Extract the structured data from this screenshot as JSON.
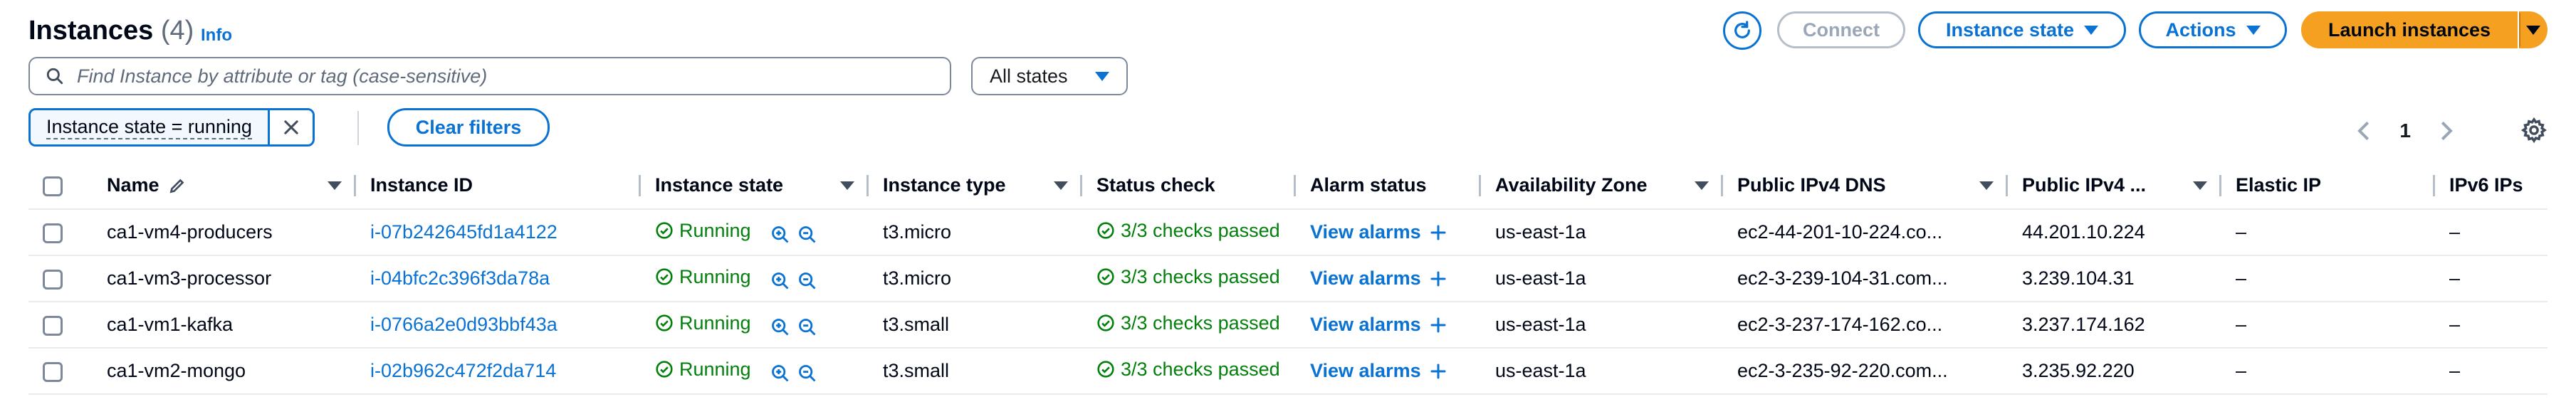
{
  "header": {
    "title": "Instances",
    "count": "(4)",
    "info": "Info",
    "connect": "Connect",
    "instance_state": "Instance state",
    "actions": "Actions",
    "launch": "Launch instances"
  },
  "filter": {
    "search_placeholder": "Find Instance by attribute or tag (case-sensitive)",
    "states_select": "All states",
    "token": "Instance state = running",
    "clear": "Clear filters"
  },
  "pagination": {
    "page": "1"
  },
  "columns": {
    "name": "Name",
    "id": "Instance ID",
    "state": "Instance state",
    "type": "Instance type",
    "status": "Status check",
    "alarm": "Alarm status",
    "az": "Availability Zone",
    "dns": "Public IPv4 DNS",
    "ip": "Public IPv4 ...",
    "eip": "Elastic IP",
    "ipv6": "IPv6 IPs"
  },
  "rows": [
    {
      "name": "ca1-vm4-producers",
      "id": "i-07b242645fd1a4122",
      "state": "Running",
      "type": "t3.micro",
      "status": "3/3 checks passed",
      "alarm": "View alarms",
      "az": "us-east-1a",
      "dns": "ec2-44-201-10-224.co...",
      "ip": "44.201.10.224",
      "eip": "–",
      "ipv6": "–"
    },
    {
      "name": "ca1-vm3-processor",
      "id": "i-04bfc2c396f3da78a",
      "state": "Running",
      "type": "t3.micro",
      "status": "3/3 checks passed",
      "alarm": "View alarms",
      "az": "us-east-1a",
      "dns": "ec2-3-239-104-31.com...",
      "ip": "3.239.104.31",
      "eip": "–",
      "ipv6": "–"
    },
    {
      "name": "ca1-vm1-kafka",
      "id": "i-0766a2e0d93bbf43a",
      "state": "Running",
      "type": "t3.small",
      "status": "3/3 checks passed",
      "alarm": "View alarms",
      "az": "us-east-1a",
      "dns": "ec2-3-237-174-162.co...",
      "ip": "3.237.174.162",
      "eip": "–",
      "ipv6": "–"
    },
    {
      "name": "ca1-vm2-mongo",
      "id": "i-02b962c472f2da714",
      "state": "Running",
      "type": "t3.small",
      "status": "3/3 checks passed",
      "alarm": "View alarms",
      "az": "us-east-1a",
      "dns": "ec2-3-235-92-220.com...",
      "ip": "3.235.92.220",
      "eip": "–",
      "ipv6": "–"
    }
  ],
  "colors": {
    "primary": "#0972d3",
    "launch": "#f5a020",
    "success": "#037f0c"
  }
}
